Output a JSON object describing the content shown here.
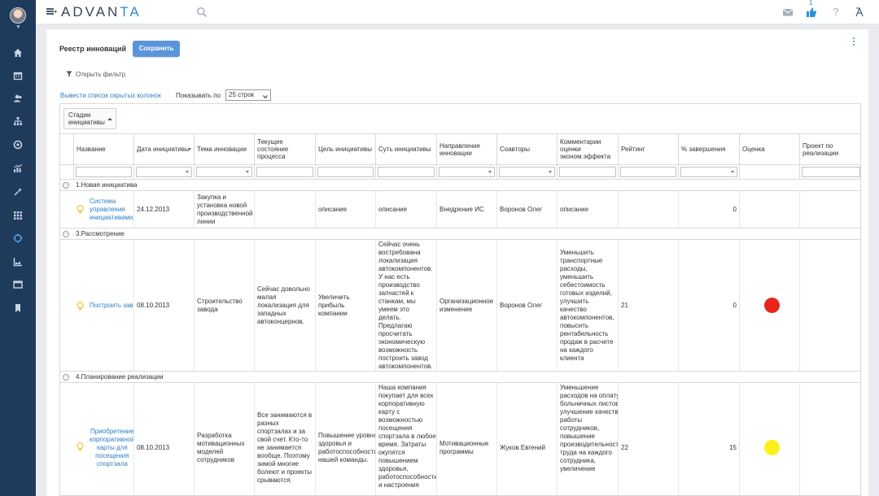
{
  "app": {
    "logo": "ADVANTA",
    "notification_count": "1"
  },
  "page": {
    "title": "Реестр инноваций",
    "save_label": "Сохранить",
    "filter_label": "Открыть фильтр",
    "hidden_columns_label": "Вывести список скрытых колонок",
    "show_label": "Показывать по",
    "rows_option": "25 строк"
  },
  "grid": {
    "group_chip": "Стадии инициативы",
    "columns": [
      "Название",
      "Дата инициативы",
      "Тема инновации",
      "Текущее состояние процесса",
      "Цель инициативы",
      "Суть инициативы",
      "Направление инновации",
      "Соавторы",
      "Комментарии оценки эконом.эффекта",
      "Рейтинг",
      "% завершения",
      "Оценка",
      "Проект по реализации"
    ],
    "groups": [
      {
        "label": "1.Новая инициатива",
        "rows": [
          {
            "name": "Система управления инициативами",
            "date": "24.12.2013",
            "topic": "Закупка и установка новой производственной линии",
            "state": "",
            "goal": "описание",
            "essence": "описание",
            "direction": "Внедрение ИС",
            "coauthors": "Воронов Олег",
            "comments": "описание",
            "rating": "",
            "completion": "0",
            "score_color": "",
            "project": ""
          }
        ]
      },
      {
        "label": "3.Рассмотрение",
        "rows": [
          {
            "name": "Построить завод автокомпонентов",
            "date": "08.10.2013",
            "topic": "Строительство завода",
            "state": "Сейчас довольно малая локализация для западных автоконцернов.",
            "goal": "Увеличить прибыль компании",
            "essence": "Сейчас очень востребована локализация автокомпонентов. У нас есть производство запчастей к станкам, мы умеем это делать. Предлагаю просчитать экономическую возможность построить завод автокомпонентов.",
            "direction": "Организационное изменение",
            "coauthors": "Воронов Олег",
            "comments": "Уменьшить транспортные расходы, уменьшить себестоимость готовых изделий, улучшить качество автокомпонентов, повысить рентабельность продаж в расчете на каждого клиента",
            "rating": "21",
            "completion": "0",
            "score_color": "#e8251a",
            "project": ""
          }
        ]
      },
      {
        "label": "4.Планирование реализации",
        "rows": [
          {
            "name": "Приобретение корпоративной карты для посещения спортзала",
            "date": "08.10.2013",
            "topic": "Разработка мотивационных моделей сотрудников",
            "state": "Все занимаются в разных спортзалах и за свой счет. Кто-то не занимается вообще. Поэтому зимой многие болеют и проекты срываются.",
            "goal": "Повышение уровня здоровья и работоспособности нашей команды.",
            "essence": "Наша компания покупает для всех корпоративную карту с возможностью посещения спортзала в любое время. Затраты окупятся повышением здоровья, работоспособности и настроения",
            "direction": "Мотивационные программы",
            "coauthors": "Жуков Евгений",
            "comments": "Уменьшение расходов на оплату больничных листов, улучшение качества работы сотрудников, повышение производительности труда на каждого сотрудника, увеличение",
            "rating": "22",
            "completion": "15",
            "score_color": "#fff019",
            "project": ""
          }
        ]
      }
    ]
  }
}
